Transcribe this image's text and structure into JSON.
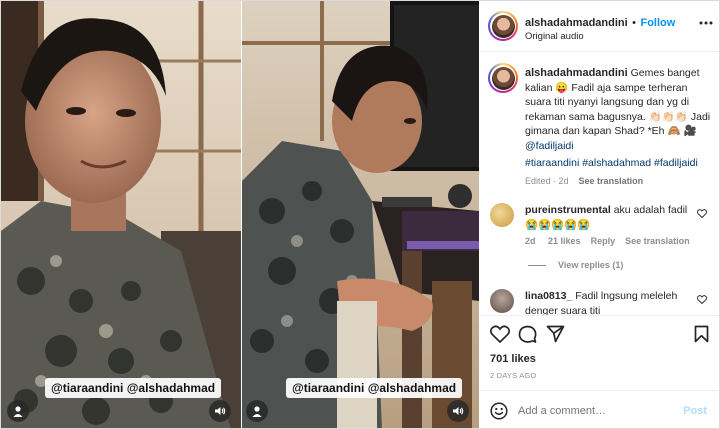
{
  "post": {
    "username": "alshadahmadandini",
    "separator": "•",
    "follow_label": "Follow",
    "audio_label": "Original audio"
  },
  "media": {
    "left_tags": "@tiaraandini @alshadahmad",
    "right_tags": "@tiaraandini @alshadahmad"
  },
  "caption": {
    "username": "alshadahmadandini",
    "text_1": "Gemes banget kalian 😛 Fadil aja sampe terheran suara titi nyanyi langsung dan yg di rekaman sama bagusnya. 👏🏻👏🏻👏🏻 Jadi gimana dan kapan Shad? *Eh 🙈",
    "tag_prefix": "🎥",
    "mention": "@fadiljaidi",
    "hashtags": "#tiaraandini #alshadahmad #fadiljaidi",
    "edited": "Edited · 2d",
    "see_translation": "See translation"
  },
  "comments": [
    {
      "username": "pureinstrumental",
      "text": "aku adalah fadil 😭😭😭😭😭",
      "time": "2d",
      "likes": "21 likes",
      "reply": "Reply",
      "translation": "See translation",
      "view_replies": "View replies (1)"
    },
    {
      "username": "lina0813_",
      "text": "Fadil lngsung meleleh denger suara titi"
    }
  ],
  "stats": {
    "likes": "701 likes",
    "date": "2 DAYS AGO"
  },
  "compose": {
    "placeholder": "Add a comment…",
    "post_label": "Post"
  },
  "icons": {
    "more": "more-icon",
    "heart": "heart-icon",
    "comment": "comment-icon",
    "share": "share-icon",
    "save": "bookmark-icon",
    "emoji": "emoji-icon",
    "user": "user-tag-icon",
    "sound": "sound-icon"
  },
  "colors": {
    "accent": "#0095f6",
    "text": "#262626",
    "muted": "#8e8e8e",
    "hashtag": "#00376b"
  }
}
